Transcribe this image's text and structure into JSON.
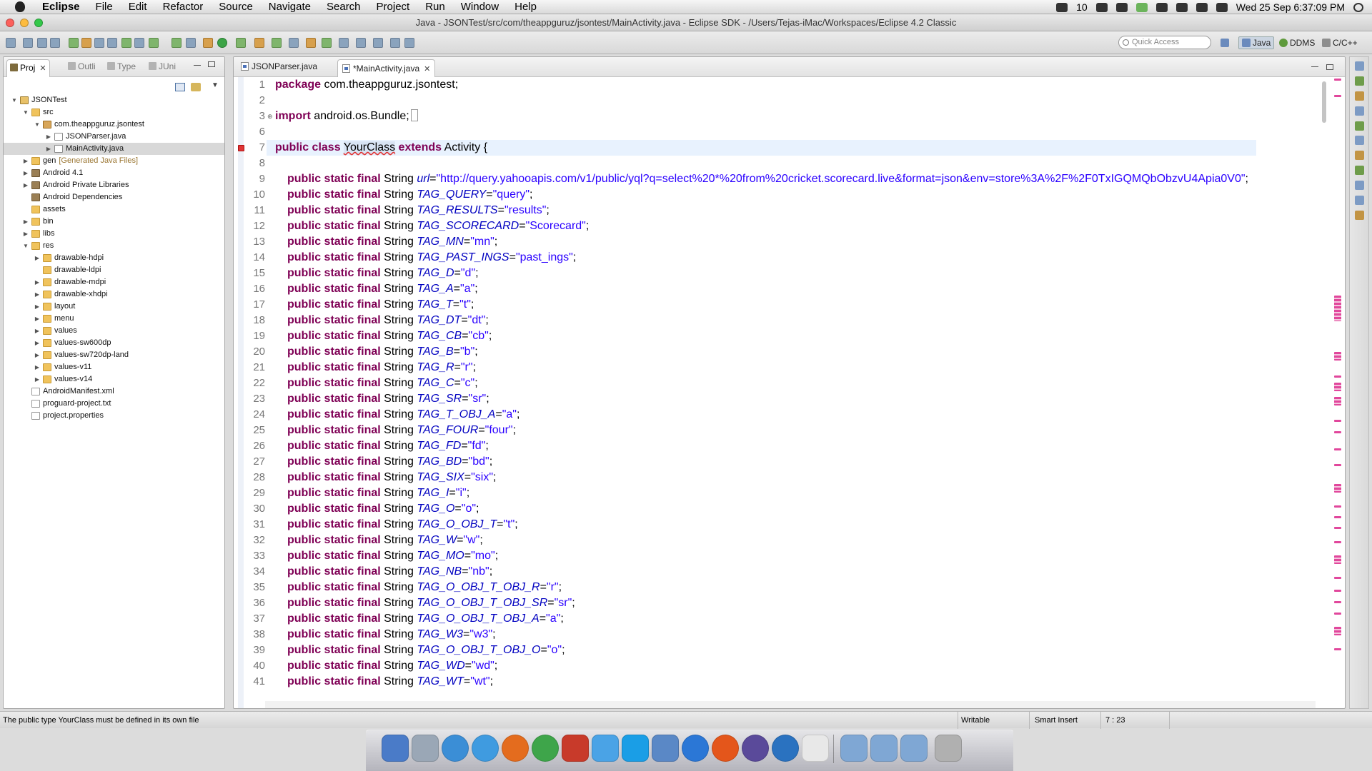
{
  "menubar": {
    "app": "Eclipse",
    "items": [
      "File",
      "Edit",
      "Refactor",
      "Source",
      "Navigate",
      "Search",
      "Project",
      "Run",
      "Window",
      "Help"
    ],
    "status_count": "10",
    "clock": "Wed 25 Sep  6:37:09 PM"
  },
  "window": {
    "title": "Java - JSONTest/src/com/theappguruz/jsontest/MainActivity.java - Eclipse SDK - /Users/Tejas-iMac/Workspaces/Eclipse 4.2 Classic"
  },
  "toolbar": {
    "quick_access_placeholder": "Quick Access",
    "perspectives": [
      "Java",
      "DDMS",
      "C/C++"
    ]
  },
  "left_panel": {
    "tabs": [
      "Proj",
      "Outli",
      "Type",
      "JUni"
    ],
    "tree": [
      {
        "label": "JSONTest",
        "level": 0,
        "icon": "project",
        "arrow": "down"
      },
      {
        "label": "src",
        "level": 1,
        "icon": "folder",
        "arrow": "down"
      },
      {
        "label": "com.theappguruz.jsontest",
        "level": 2,
        "icon": "pkg",
        "arrow": "down"
      },
      {
        "label": "JSONParser.java",
        "level": 3,
        "icon": "java",
        "arrow": "right"
      },
      {
        "label": "MainActivity.java",
        "level": 3,
        "icon": "java",
        "arrow": "right",
        "selected": true
      },
      {
        "label": "gen",
        "note": "[Generated Java Files]",
        "level": 1,
        "icon": "folder",
        "arrow": "right"
      },
      {
        "label": "Android 4.1",
        "level": 1,
        "icon": "lib",
        "arrow": "right"
      },
      {
        "label": "Android Private Libraries",
        "level": 1,
        "icon": "lib",
        "arrow": "right"
      },
      {
        "label": "Android Dependencies",
        "level": 1,
        "icon": "lib",
        "arrow": ""
      },
      {
        "label": "assets",
        "level": 1,
        "icon": "folder",
        "arrow": ""
      },
      {
        "label": "bin",
        "level": 1,
        "icon": "folder",
        "arrow": "right"
      },
      {
        "label": "libs",
        "level": 1,
        "icon": "folder",
        "arrow": "right"
      },
      {
        "label": "res",
        "level": 1,
        "icon": "folder",
        "arrow": "down"
      },
      {
        "label": "drawable-hdpi",
        "level": 2,
        "icon": "folder",
        "arrow": "right"
      },
      {
        "label": "drawable-ldpi",
        "level": 2,
        "icon": "folder",
        "arrow": ""
      },
      {
        "label": "drawable-mdpi",
        "level": 2,
        "icon": "folder",
        "arrow": "right"
      },
      {
        "label": "drawable-xhdpi",
        "level": 2,
        "icon": "folder",
        "arrow": "right"
      },
      {
        "label": "layout",
        "level": 2,
        "icon": "folder",
        "arrow": "right"
      },
      {
        "label": "menu",
        "level": 2,
        "icon": "folder",
        "arrow": "right"
      },
      {
        "label": "values",
        "level": 2,
        "icon": "folder",
        "arrow": "right"
      },
      {
        "label": "values-sw600dp",
        "level": 2,
        "icon": "folder",
        "arrow": "right"
      },
      {
        "label": "values-sw720dp-land",
        "level": 2,
        "icon": "folder",
        "arrow": "right"
      },
      {
        "label": "values-v11",
        "level": 2,
        "icon": "folder",
        "arrow": "right"
      },
      {
        "label": "values-v14",
        "level": 2,
        "icon": "folder",
        "arrow": "right"
      },
      {
        "label": "AndroidManifest.xml",
        "level": 1,
        "icon": "file",
        "arrow": ""
      },
      {
        "label": "proguard-project.txt",
        "level": 1,
        "icon": "file",
        "arrow": ""
      },
      {
        "label": "project.properties",
        "level": 1,
        "icon": "file",
        "arrow": ""
      }
    ]
  },
  "editor": {
    "tabs": [
      "JSONParser.java",
      "*MainActivity.java"
    ],
    "active_tab": 1,
    "header_lines": [
      {
        "n": "1",
        "kw": "package",
        "rest": " com.theappguruz.jsontest;"
      },
      {
        "n": "2"
      },
      {
        "n": "3",
        "kw": "import",
        "rest": " android.os.Bundle;"
      },
      {
        "n": "6"
      },
      {
        "n": "7",
        "kw": "public class",
        "cls": "YourClass",
        "kw2": " extends",
        "rest": " Activity {"
      },
      {
        "n": "8"
      }
    ],
    "fields": [
      {
        "n": "9",
        "name": "url",
        "value": "\"http://query.yahooapis.com/v1/public/yql?q=select%20*%20from%20cricket.scorecard.live&format=json&env=store%3A%2F%2F0TxIGQMQbObzvU4Apia0V0\""
      },
      {
        "n": "10",
        "name": "TAG_QUERY",
        "value": "\"query\""
      },
      {
        "n": "11",
        "name": "TAG_RESULTS",
        "value": "\"results\""
      },
      {
        "n": "12",
        "name": "TAG_SCORECARD",
        "value": "\"Scorecard\""
      },
      {
        "n": "13",
        "name": "TAG_MN",
        "value": "\"mn\""
      },
      {
        "n": "14",
        "name": "TAG_PAST_INGS",
        "value": "\"past_ings\""
      },
      {
        "n": "15",
        "name": "TAG_D",
        "value": "\"d\""
      },
      {
        "n": "16",
        "name": "TAG_A",
        "value": "\"a\""
      },
      {
        "n": "17",
        "name": "TAG_T",
        "value": "\"t\""
      },
      {
        "n": "18",
        "name": "TAG_DT",
        "value": "\"dt\""
      },
      {
        "n": "19",
        "name": "TAG_CB",
        "value": "\"cb\""
      },
      {
        "n": "20",
        "name": "TAG_B",
        "value": "\"b\""
      },
      {
        "n": "21",
        "name": "TAG_R",
        "value": "\"r\""
      },
      {
        "n": "22",
        "name": "TAG_C",
        "value": "\"c\""
      },
      {
        "n": "23",
        "name": "TAG_SR",
        "value": "\"sr\""
      },
      {
        "n": "24",
        "name": "TAG_T_OBJ_A",
        "value": "\"a\""
      },
      {
        "n": "25",
        "name": "TAG_FOUR",
        "value": "\"four\""
      },
      {
        "n": "26",
        "name": "TAG_FD",
        "value": "\"fd\""
      },
      {
        "n": "27",
        "name": "TAG_BD",
        "value": "\"bd\""
      },
      {
        "n": "28",
        "name": "TAG_SIX",
        "value": "\"six\""
      },
      {
        "n": "29",
        "name": "TAG_I",
        "value": "\"i\""
      },
      {
        "n": "30",
        "name": "TAG_O",
        "value": "\"o\""
      },
      {
        "n": "31",
        "name": "TAG_O_OBJ_T",
        "value": "\"t\""
      },
      {
        "n": "32",
        "name": "TAG_W",
        "value": "\"w\""
      },
      {
        "n": "33",
        "name": "TAG_MO",
        "value": "\"mo\""
      },
      {
        "n": "34",
        "name": "TAG_NB",
        "value": "\"nb\""
      },
      {
        "n": "35",
        "name": "TAG_O_OBJ_T_OBJ_R",
        "value": "\"r\""
      },
      {
        "n": "36",
        "name": "TAG_O_OBJ_T_OBJ_SR",
        "value": "\"sr\""
      },
      {
        "n": "37",
        "name": "TAG_O_OBJ_T_OBJ_A",
        "value": "\"a\""
      },
      {
        "n": "38",
        "name": "TAG_W3",
        "value": "\"w3\""
      },
      {
        "n": "39",
        "name": "TAG_O_OBJ_T_OBJ_O",
        "value": "\"o\""
      },
      {
        "n": "40",
        "name": "TAG_WD",
        "value": "\"wd\""
      },
      {
        "n": "41",
        "name": "TAG_WT",
        "value": "\"wt\""
      }
    ],
    "field_prefix": "public static final",
    "field_type": " String "
  },
  "statusbar": {
    "message": "The public type YourClass must be defined in its own file",
    "writable": "Writable",
    "insert_mode": "Smart Insert",
    "position": "7 : 23"
  },
  "colors": {
    "keyword": "#7f0055",
    "field": "#0000c0",
    "string": "#2a00ff",
    "error_marker": "#e1479c"
  },
  "dock": {
    "icons": [
      "finder-icon",
      "photo-icon",
      "itunes-icon",
      "safari-icon",
      "firefox-icon",
      "chrome-icon",
      "filezilla-icon",
      "messages-icon",
      "skype-icon",
      "xcode-icon",
      "appstore-icon",
      "flash-icon",
      "eclipse-icon",
      "sourcetree-icon",
      "java-icon",
      "folder-icon",
      "folder-icon",
      "folder-icon",
      "trash-icon"
    ]
  }
}
